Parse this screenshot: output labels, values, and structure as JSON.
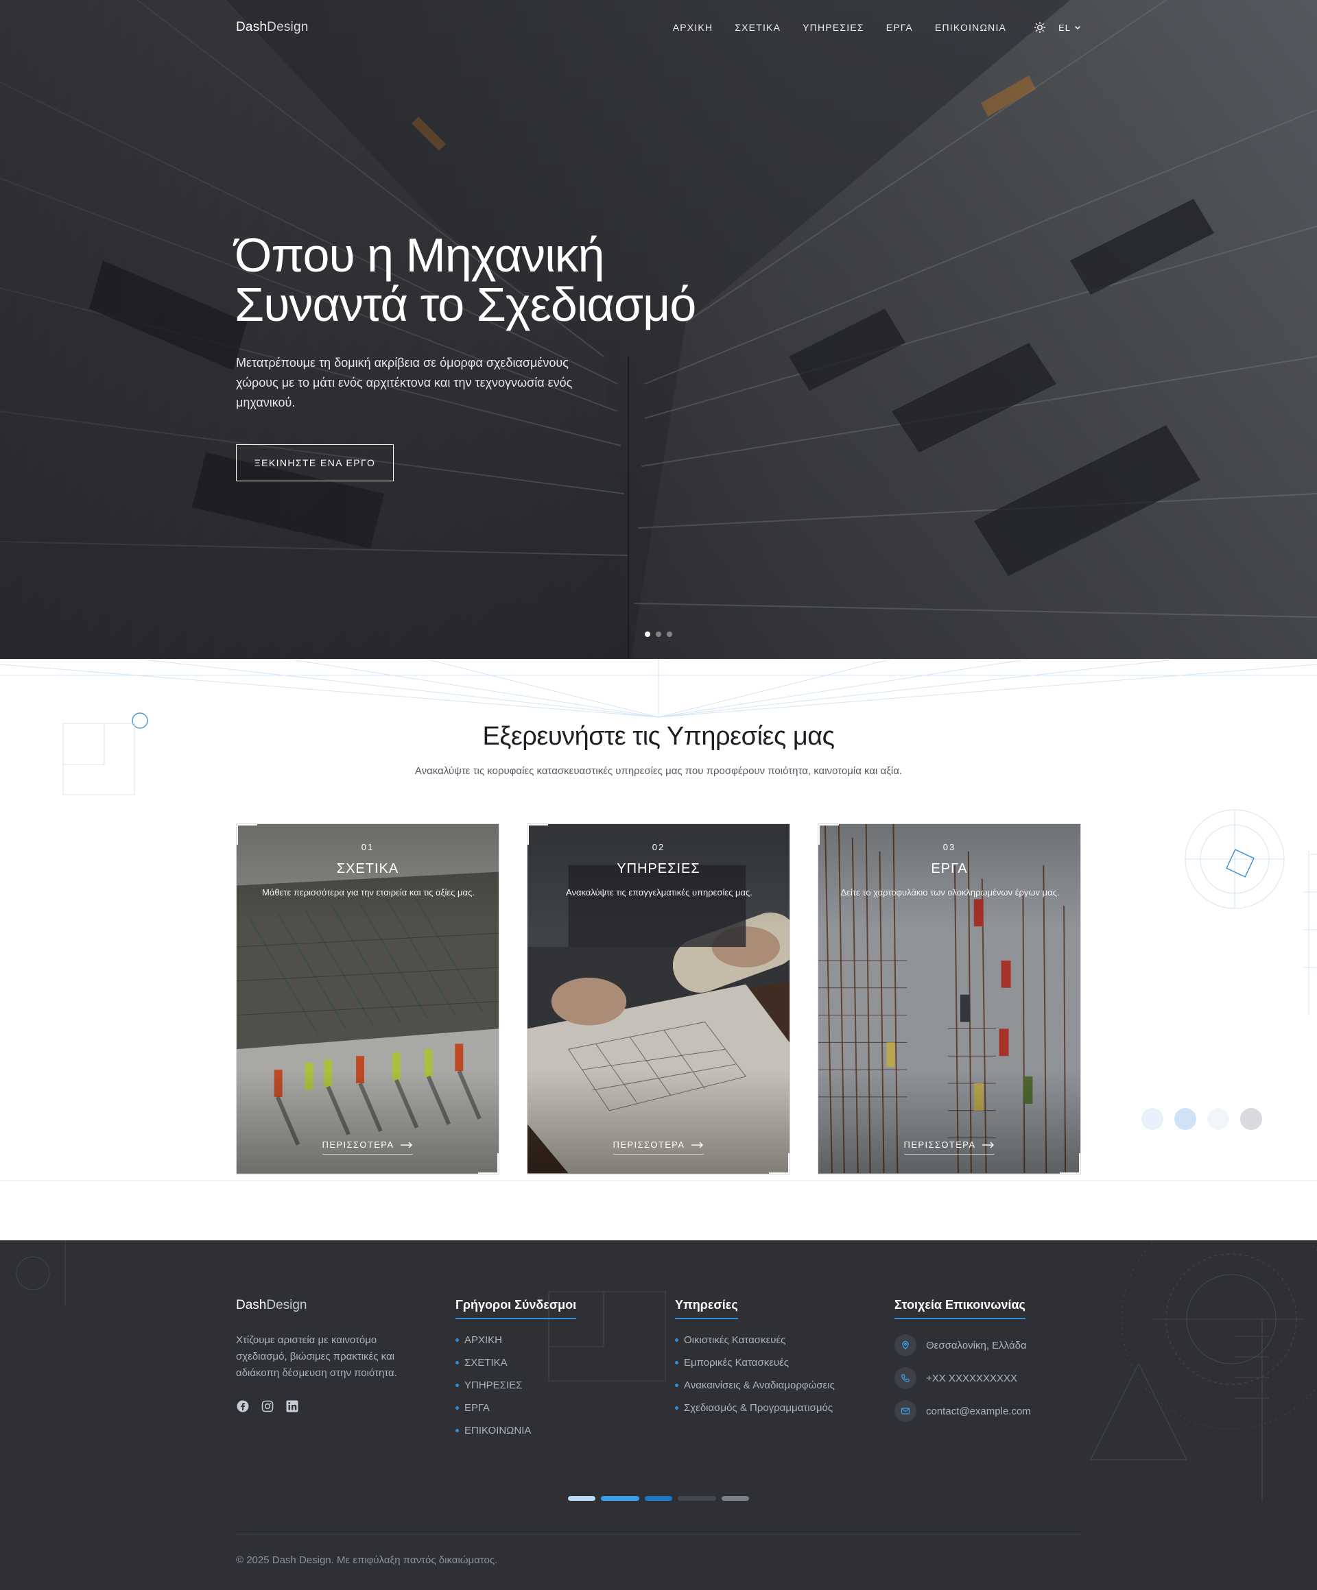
{
  "header": {
    "logo_bold": "Dash",
    "logo_light": "Design",
    "nav": [
      "ΑΡΧΙΚΗ",
      "ΣΧΕΤΙΚΑ",
      "ΥΠΗΡΕΣΙΕΣ",
      "ΕΡΓΑ",
      "ΕΠΙΚΟΙΝΩΝΙΑ"
    ],
    "theme_icon": "sun-icon",
    "language": "EL",
    "language_icon": "chevron-down-icon"
  },
  "hero": {
    "title_line1": "Όπου η Μηχανική",
    "title_line2": "Συναντά το Σχεδιασμό",
    "subtitle": "Μετατρέπουμε τη δομική ακρίβεια σε όμορφα σχεδιασμένους χώρους με το μάτι ενός αρχιτέκτονα και την τεχνογνωσία ενός μηχανικού.",
    "cta": "ΞΕΚΙΝΗΣΤΕ ΕΝΑ ΕΡΓΟ",
    "slides": 3,
    "active_slide": 1
  },
  "services": {
    "title": "Εξερευνήστε τις Υπηρεσίες μας",
    "subtitle": "Ανακαλύψτε τις κορυφαίες κατασκευαστικές υπηρεσίες μας που προσφέρουν ποιότητα, καινοτομία και αξία.",
    "cards": [
      {
        "num": "01",
        "title": "ΣΧΕΤΙΚΑ",
        "desc": "Μάθετε περισσότερα για την εταιρεία και τις αξίες μας.",
        "more": "ΠΕΡΙΣΣΟΤΕΡΑ"
      },
      {
        "num": "02",
        "title": "ΥΠΗΡΕΣΙΕΣ",
        "desc": "Ανακαλύψτε τις επαγγελματικές υπηρεσίες μας.",
        "more": "ΠΕΡΙΣΣΟΤΕΡΑ"
      },
      {
        "num": "03",
        "title": "ΕΡΓΑ",
        "desc": "Δείτε το χαρτοφυλάκιο των ολοκληρωμένων έργων μας.",
        "more": "ΠΕΡΙΣΣΟΤΕΡΑ"
      }
    ],
    "palette": [
      "#e9f1fb",
      "#cfe3f6",
      "#f2f5f9",
      "#d9dadd"
    ]
  },
  "footer": {
    "logo_bold": "Dash",
    "logo_light": "Design",
    "about": "Χτίζουμε αριστεία με καινοτόμο σχεδιασμό, βιώσιμες πρακτικές και αδιάκοπη δέσμευση στην ποιότητα.",
    "socials": [
      "facebook-icon",
      "instagram-icon",
      "linkedin-icon"
    ],
    "quick_title": "Γρήγοροι Σύνδεσμοι",
    "quick_links": [
      "ΑΡΧΙΚΗ",
      "ΣΧΕΤΙΚΑ",
      "ΥΠΗΡΕΣΙΕΣ",
      "ΕΡΓΑ",
      "ΕΠΙΚΟΙΝΩΝΙΑ"
    ],
    "services_title": "Υπηρεσίες",
    "services_links": [
      "Οικιστικές Κατασκευές",
      "Εμπορικές Κατασκευές",
      "Ανακαινίσεις & Αναδιαμορφώσεις",
      "Σχεδιασμός & Προγραμματισμός"
    ],
    "contact_title": "Στοιχεία Επικοινωνίας",
    "contact": [
      {
        "icon": "location-icon",
        "text": "Θεσσαλονίκη, Ελλάδα"
      },
      {
        "icon": "phone-icon",
        "text": "+XX XXXXXXXXXX"
      },
      {
        "icon": "mail-icon",
        "text": "contact@example.com"
      }
    ],
    "palette": [
      "#b9dcf6",
      "#3aa0e6",
      "#1b78c9",
      "#454850",
      "#7d8088"
    ],
    "copyright": "© 2025 Dash Design. Με επιφύλαξη παντός δικαιώματος."
  },
  "colors": {
    "accent": "#2f8fd8",
    "footer_bg": "#2e3035",
    "hero_bg": "#2b2d31"
  }
}
